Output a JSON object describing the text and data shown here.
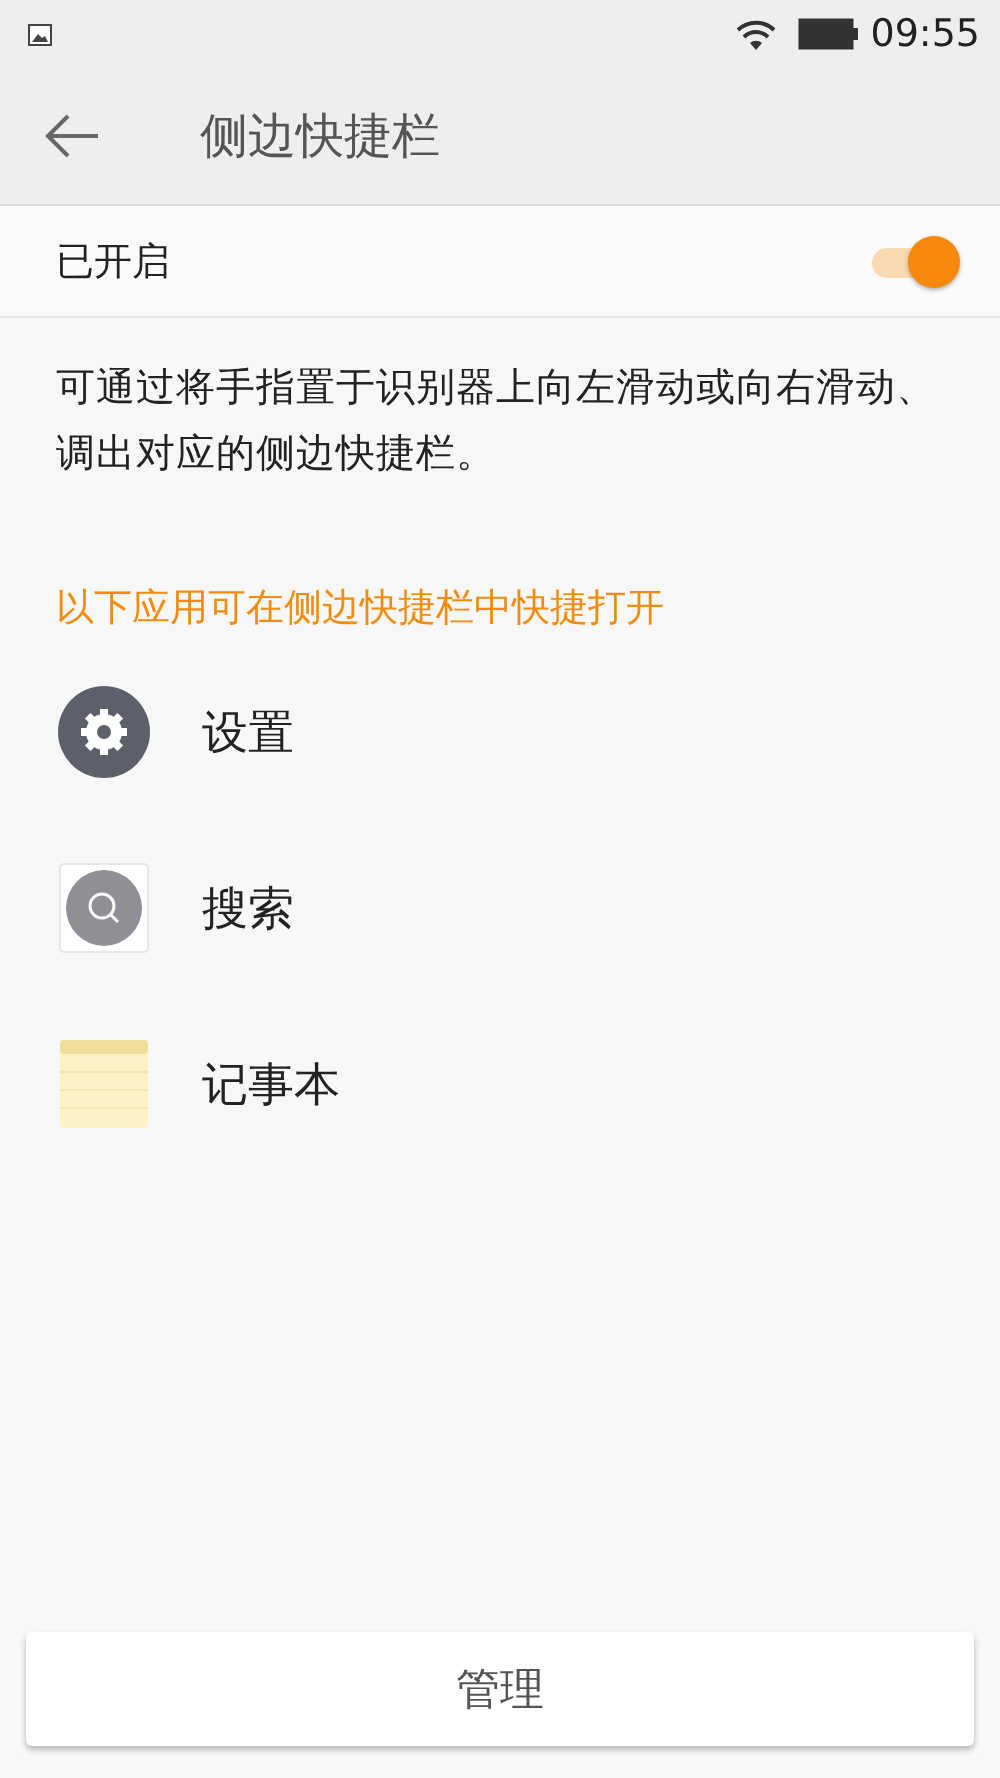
{
  "status_bar": {
    "time": "09:55"
  },
  "app_bar": {
    "title": "侧边快捷栏"
  },
  "toggle": {
    "label": "已开启",
    "on": true
  },
  "description": "可通过将手指置于识别器上向左滑动或向右滑动、调出对应的侧边快捷栏。",
  "section_header": "以下应用可在侧边快捷栏中快捷打开",
  "apps": [
    {
      "kind": "settings",
      "label": "设置"
    },
    {
      "kind": "search",
      "label": "搜索"
    },
    {
      "kind": "notes",
      "label": "记事本"
    }
  ],
  "buttons": [
    "管理"
  ]
}
